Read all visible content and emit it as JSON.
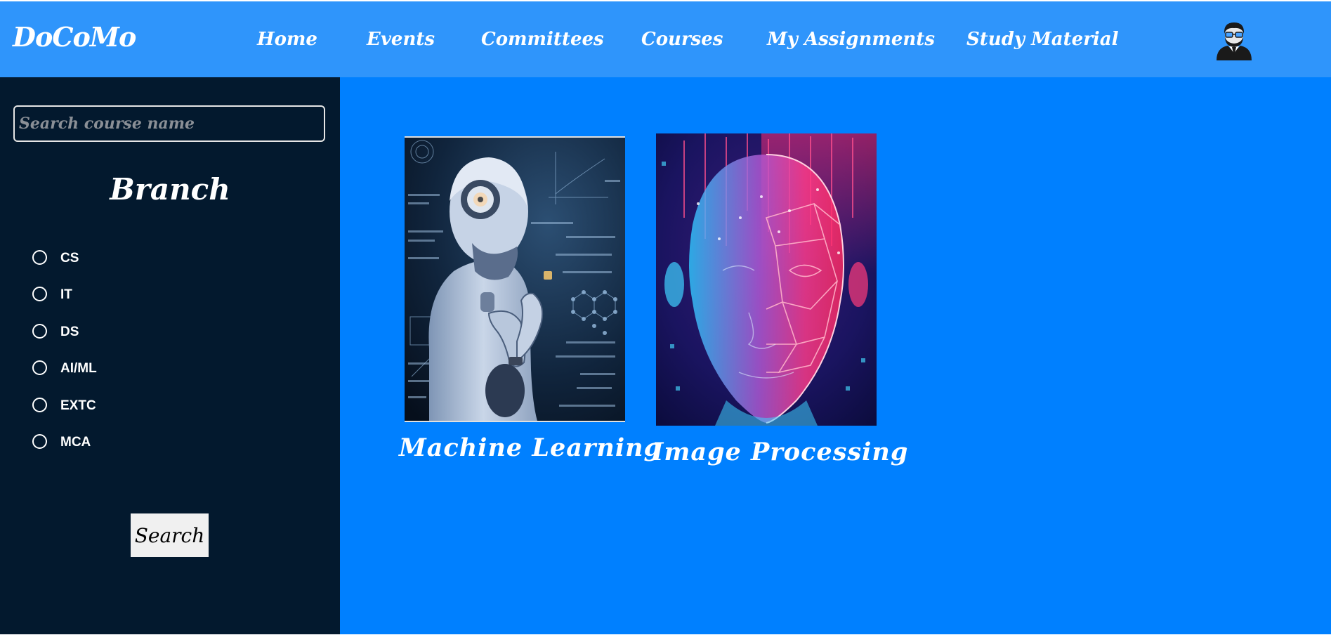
{
  "navbar": {
    "brand": "DoCoMo",
    "links": [
      "Home",
      "Events",
      "Committees",
      "Courses",
      "My Assignments",
      "Study Material"
    ],
    "avatar_icon": "user-avatar-icon"
  },
  "sidebar": {
    "search_placeholder": "Search course name",
    "branch_heading": "Branch",
    "branches": [
      "CS",
      "IT",
      "DS",
      "AI/ML",
      "EXTC",
      "MCA"
    ],
    "search_button": "Search"
  },
  "courses": [
    {
      "title": "Machine Learning",
      "image": "robot-thinking-with-formulas"
    },
    {
      "title": "Image Processing",
      "image": "digital-face-wireframe"
    }
  ],
  "colors": {
    "navbar": "#2f95fb",
    "sidebar": "#03192e",
    "main": "#0080ff",
    "text": "#ffffff"
  }
}
